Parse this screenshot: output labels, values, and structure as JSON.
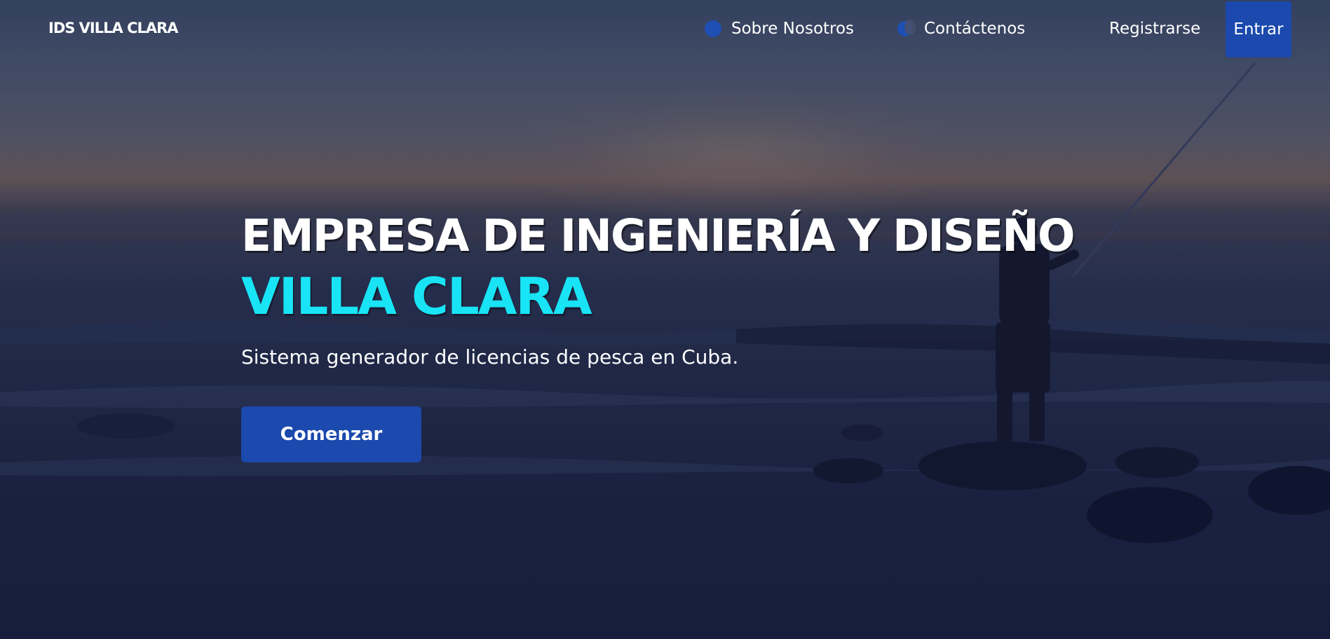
{
  "nav": {
    "brand": "IDS VILLA CLARA",
    "links": [
      {
        "label": "Sobre Nosotros",
        "icon": "info-icon"
      },
      {
        "label": "Contáctenos",
        "icon": "moon-icon"
      }
    ],
    "register_label": "Registrarse",
    "login_label": "Entrar"
  },
  "hero": {
    "title_line1": "EMPRESA DE INGENIERÍA Y DISEÑO",
    "title_line2": "VILLA CLARA",
    "tagline": "Sistema generador de licencias de pesca en Cuba.",
    "cta_label": "Comenzar",
    "background": "fisherman-at-sunset-sea-photo"
  },
  "colors": {
    "accent_blue": "#1b49ad",
    "highlight_cyan": "#18e4f5",
    "text": "#ffffff"
  }
}
